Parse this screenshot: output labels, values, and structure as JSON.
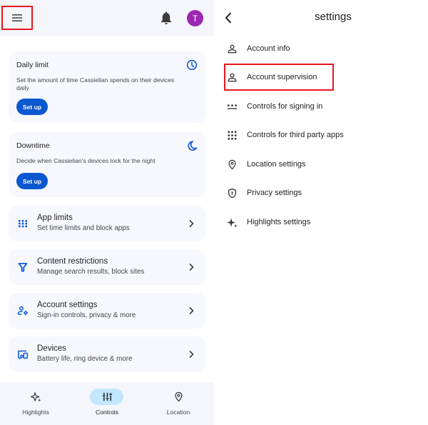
{
  "left": {
    "header": {
      "menu_icon": "hamburger-menu-icon",
      "notification_icon": "bell-icon",
      "avatar_initial": "T",
      "avatar_color": "#9c27b0"
    },
    "cards": [
      {
        "title": "Daily limit",
        "description": "Set the amount of time Cassielian spends on their devices daily",
        "button": "Set up",
        "icon": "clock-icon"
      },
      {
        "title": "Downtime",
        "description": "Decide when Cassielian's devices lock for the night",
        "button": "Set up",
        "icon": "moon-icon"
      }
    ],
    "rows": [
      {
        "title": "App limits",
        "subtitle": "Set time limits and block apps",
        "icon": "apps-grid-icon"
      },
      {
        "title": "Content restrictions",
        "subtitle": "Manage search results, block sites",
        "icon": "filter-icon"
      },
      {
        "title": "Account settings",
        "subtitle": "Sign-in controls, privacy & more",
        "icon": "account-settings-icon"
      },
      {
        "title": "Devices",
        "subtitle": "Battery life, ring device & more",
        "icon": "devices-icon"
      }
    ],
    "bottom_nav": [
      {
        "label": "Highlights",
        "icon": "sparkle-icon",
        "active": false
      },
      {
        "label": "Controls",
        "icon": "sliders-icon",
        "active": true
      },
      {
        "label": "Location",
        "icon": "location-pin-icon",
        "active": false
      }
    ]
  },
  "right": {
    "title": "settings",
    "back_icon": "chevron-left-icon",
    "items": [
      {
        "label": "Account info",
        "icon": "person-icon"
      },
      {
        "label": "Account supervision",
        "icon": "person-icon",
        "highlighted": true
      },
      {
        "label": "Controls for signing in",
        "icon": "password-dots-icon"
      },
      {
        "label": "Controls for third party apps",
        "icon": "apps-grid-icon"
      },
      {
        "label": "Location settings",
        "icon": "location-pin-icon"
      },
      {
        "label": "Privacy settings",
        "icon": "shield-icon"
      },
      {
        "label": "Highlights settings",
        "icon": "sparkle-icon"
      }
    ]
  },
  "colors": {
    "accent": "#0b57d0",
    "highlight_box": "#e8151b",
    "nav_active": "#c2e7ff",
    "card_bg": "#f6f8fd"
  }
}
